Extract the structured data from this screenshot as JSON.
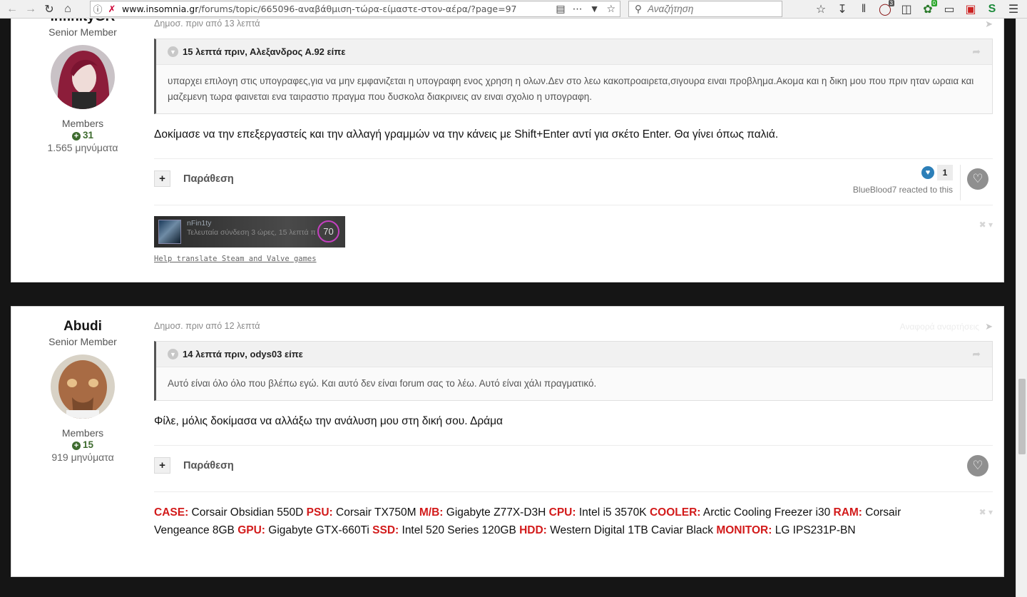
{
  "browser": {
    "url_host": "www.insomnia.gr",
    "url_path": "/forums/topic/665096-αναβάθμιση-τώρα-είμαστε-στον-αέρα/?page=97",
    "search_placeholder": "Αναζήτηση",
    "badge_ublock": "3",
    "badge_green": "0"
  },
  "post1": {
    "author": {
      "name": "InfinityGR",
      "rank": "Senior Member",
      "group": "Members",
      "reputation": "31",
      "posts": "1.565 μηνύματα"
    },
    "meta": "Δημοσ. πριν από 13 λεπτά",
    "quote_header": "15 λεπτά πριν, Αλεξανδρος Α.92 είπε",
    "quote_text": "υπαρχει επιλογη στις υπογραφες,για να μην εμφανιζεται η υπογραφη ενος χρηση η ολων.Δεν στο λεω κακοπροαιρετα,σιγουρα ειναι προβλημα.Ακομα και η δικη μου που πριν ηταν ωραια και μαζεμενη τωρα φαινεται ενα ταιραστιο πραγμα που δυσκολα διακρινεις αν ειναι σχολιο η υπογραφη.",
    "content": "Δοκίμασε να την επεξεργαστείς και την αλλαγή γραμμών να την κάνεις με Shift+Enter αντί για σκέτο Enter. Θα γίνει όπως παλιά.",
    "quote_button": "Παράθεση",
    "reaction_count": "1",
    "reacted_text": "BlueBlood7 reacted to this",
    "steam": {
      "name": "nFin1ty",
      "status": "Τελευταία σύνδεση 3 ώρες, 15 λεπτά π",
      "level": "70"
    },
    "sig_link": "Help translate Steam and Valve games"
  },
  "post2": {
    "author": {
      "name": "Abudi",
      "rank": "Senior Member",
      "group": "Members",
      "reputation": "15",
      "posts": "919 μηνύματα"
    },
    "meta": "Δημοσ. πριν από 12 λεπτά",
    "meta_right": "Αναφορά αναρτήσεις",
    "quote_header": "14 λεπτά πριν, odys03 είπε",
    "quote_text": "Αυτό είναι όλο όλο που βλέπω εγώ. Και αυτό δεν είναι forum σας το λέω. Αυτό είναι χάλι πραγματικό.",
    "content": "Φίλε, μόλις δοκίμασα να αλλάξω την ανάλυση μου στη δική σου. Δράμα",
    "quote_button": "Παράθεση",
    "specs": [
      {
        "k": "CASE:",
        "v": "Corsair Obsidian 550D"
      },
      {
        "k": "PSU:",
        "v": "Corsair TX750M"
      },
      {
        "k": "M/B:",
        "v": "Gigabyte Z77X-D3H"
      },
      {
        "k": "CPU:",
        "v": "Intel i5 3570K"
      },
      {
        "k": "COOLER:",
        "v": "Arctic Cooling Freezer i30"
      },
      {
        "k": "RAM:",
        "v": "Corsair Vengeance 8GB"
      },
      {
        "k": "GPU:",
        "v": "Gigabyte GTX-660Ti"
      },
      {
        "k": "SSD:",
        "v": "Intel 520 Series 120GB"
      },
      {
        "k": "HDD:",
        "v": "Western Digital 1TB Caviar Black"
      },
      {
        "k": "MONITOR:",
        "v": "LG IPS231P-BN"
      }
    ]
  },
  "colors": {
    "spec_key": "#d21a1a",
    "reputation": "#3e6b2f",
    "reaction_blue": "#2c7fb8",
    "steam_level_ring": "#c43fc0"
  }
}
